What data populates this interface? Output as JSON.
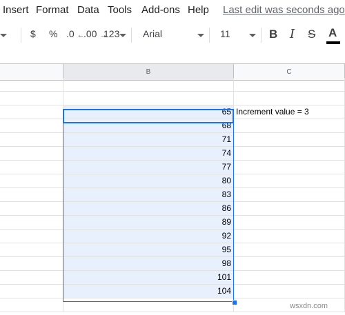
{
  "menu": {
    "items": [
      "Insert",
      "Format",
      "Data",
      "Tools",
      "Add-ons",
      "Help"
    ],
    "last_edit": "Last edit was seconds ago"
  },
  "toolbar": {
    "currency": "$",
    "percent": "%",
    "decrease_decimals": ".0",
    "increase_decimals": ".00",
    "more_formats": "123",
    "font": "Arial",
    "font_size": "11",
    "bold": "B",
    "italic": "I",
    "strikethrough": "S",
    "text_color": "A",
    "text_color_value": "#000000"
  },
  "columns": [
    {
      "label": "B",
      "selected": true
    },
    {
      "label": "C",
      "selected": false
    }
  ],
  "cells_b": [
    "",
    "",
    "65",
    "68",
    "71",
    "74",
    "77",
    "80",
    "83",
    "86",
    "89",
    "92",
    "95",
    "98",
    "101",
    "104",
    ""
  ],
  "cells_c": [
    "",
    "",
    "Increment value = 3",
    "",
    "",
    "",
    "",
    "",
    "",
    "",
    "",
    "",
    "",
    "",
    "",
    "",
    ""
  ],
  "selection": {
    "start_row_index": 2,
    "end_row_index": 15
  },
  "watermark": "wsxdn.com",
  "colors": {
    "accent": "#1a73e8",
    "selection_fill": "#e8f0fe"
  }
}
